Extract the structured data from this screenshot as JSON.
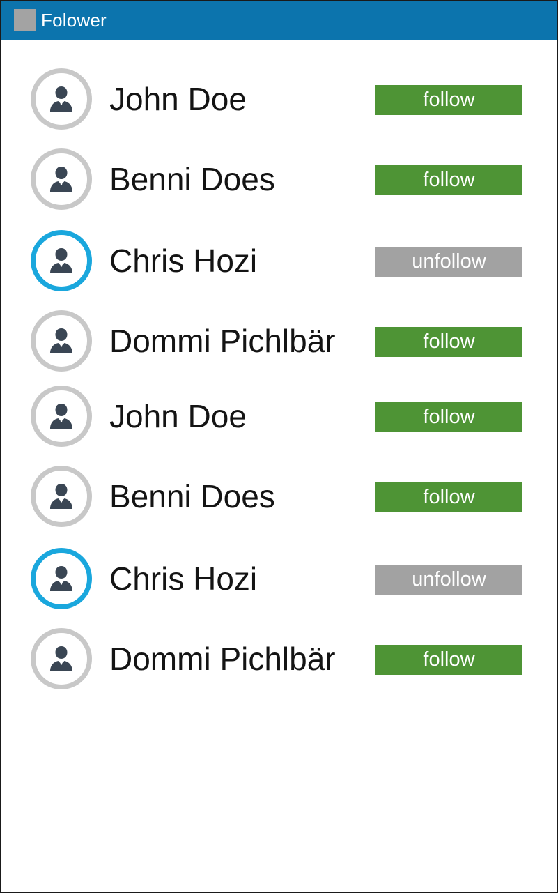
{
  "app": {
    "title": "Folower"
  },
  "colors": {
    "header": "#0c74ad",
    "follow": "#4e9435",
    "unfollow": "#a2a2a2",
    "ring_default": "#c8c8c8",
    "ring_active": "#1aa7dd"
  },
  "followers": [
    {
      "name": "John Doe",
      "action": "follow",
      "followed": false
    },
    {
      "name": "Benni Does",
      "action": "follow",
      "followed": false
    },
    {
      "name": "Chris Hozi",
      "action": "unfollow",
      "followed": true
    },
    {
      "name": "Dommi Pichlbär",
      "action": "follow",
      "followed": false
    },
    {
      "name": "John Doe",
      "action": "follow",
      "followed": false
    },
    {
      "name": "Benni Does",
      "action": "follow",
      "followed": false
    },
    {
      "name": "Chris Hozi",
      "action": "unfollow",
      "followed": true
    },
    {
      "name": "Dommi Pichlbär",
      "action": "follow",
      "followed": false
    }
  ],
  "icons": {
    "app": "app-icon",
    "avatar": "user-silhouette-icon"
  }
}
